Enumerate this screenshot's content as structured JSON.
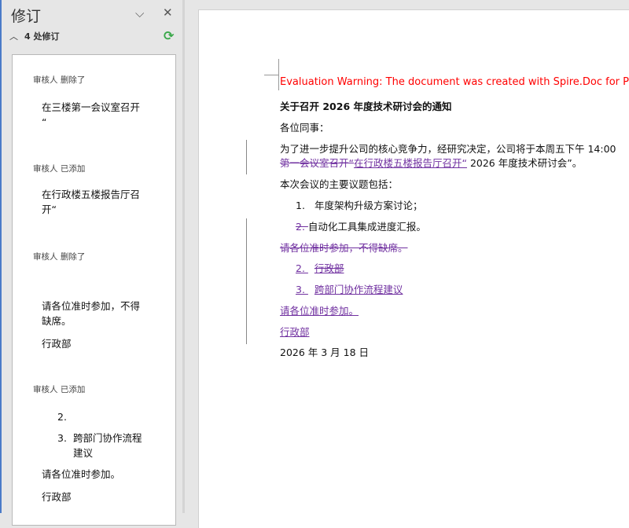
{
  "pane": {
    "title": "修订",
    "count_label": "4 处修订",
    "collapse_icon": "chevron-down",
    "close_icon": "close",
    "refresh_icon": "refresh",
    "refresh_color": "#3aa84a"
  },
  "revisions": [
    {
      "meta": "审核人  删除了",
      "lines": [
        "在三楼第一会议室召开",
        "“"
      ]
    },
    {
      "meta": "审核人  已添加",
      "lines": [
        "在行政楼五楼报告厅召",
        "开“"
      ]
    },
    {
      "meta": "审核人  删除了",
      "lines": [
        "请各位准时参加，不得",
        "缺席。",
        "行政部"
      ]
    },
    {
      "meta": "审核人  已添加",
      "list": [
        {
          "num": "2.",
          "text": ""
        },
        {
          "num": "3.",
          "text": "跨部门协作流程",
          "text2": "建议"
        }
      ],
      "lines": [
        "请各位准时参加。",
        "行政部"
      ]
    }
  ],
  "document": {
    "warning": "Evaluation Warning: The document was created with Spire.Doc for Python",
    "warning_color": "#ff0000",
    "title": "关于召开 2026 年度技术研讨会的通知",
    "greeting": "各位同事：",
    "body1": "为了进一步提升公司的核心竞争力，经研究决定，公司将于本周五下午 14:00",
    "body2_del": "第一会议室召开“",
    "body2_ins": "在行政楼五楼报告厅召开“",
    "body2_rest": " 2026 年度技术研讨会”。",
    "topics_intro": "本次会议的主要议题包括：",
    "item1_num": "1.",
    "item1": "年度架构升级方案讨论；",
    "item2_num_del": "2. ",
    "item2": "自动化工具集成进度汇报。",
    "del_para": "请各位准时参加，不得缺席。",
    "ins_item2_num": "2. ",
    "ins_item2": "行政部",
    "ins_item3_num": "3. ",
    "ins_item3": "跨部门协作流程建议",
    "ins_para": "请各位准时参加。",
    "ins_sign": "行政部",
    "date": "2026 年 3 月 18 日",
    "revision_color": "#7030a0"
  }
}
